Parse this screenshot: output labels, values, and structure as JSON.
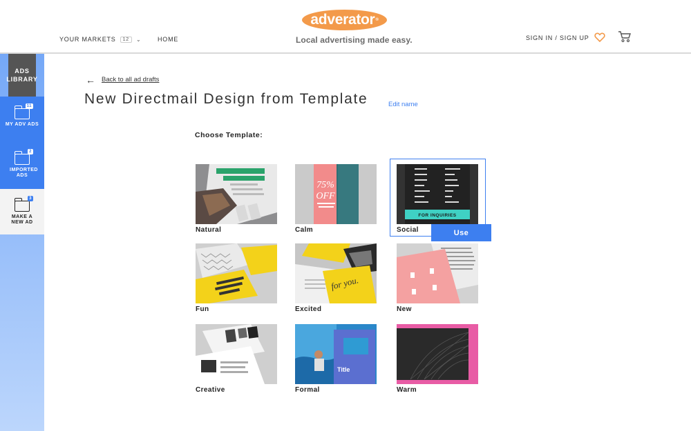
{
  "header": {
    "markets_label": "YOUR MARKETS",
    "markets_count": "12",
    "home_label": "HOME",
    "logo_text": "adverator",
    "logo_mark": "®",
    "tagline": "Local advertising made easy.",
    "signin_label": "SIGN IN / SIGN UP",
    "icons": [
      "chevron-down-icon",
      "heart-icon",
      "cart-icon"
    ]
  },
  "sidebar": {
    "library_title": "ADS LIBRARY",
    "items": [
      {
        "label": "MY ADV ADS",
        "badge": "11"
      },
      {
        "label": "IMPORTED ADS",
        "badge": "2"
      },
      {
        "label": "MAKE A NEW AD",
        "badge": "3"
      }
    ]
  },
  "main": {
    "back_label": "Back to all ad drafts",
    "title": "New Directmail Design from Template",
    "edit_label": "Edit name",
    "choose_label": "Choose Template:",
    "use_label": "Use",
    "templates": [
      {
        "name": "Natural"
      },
      {
        "name": "Calm",
        "thumb_text": "75% OFF"
      },
      {
        "name": "Social",
        "thumb_text": "FOR INQUIRIES"
      },
      {
        "name": "Fun"
      },
      {
        "name": "Excited",
        "thumb_text": "for you."
      },
      {
        "name": "New"
      },
      {
        "name": "Creative"
      },
      {
        "name": "Formal",
        "thumb_text": "Title"
      },
      {
        "name": "Warm"
      }
    ]
  },
  "colors": {
    "brand": "#f39a4a",
    "accent": "#3d7ff0",
    "sidebar_dark": "#555555"
  }
}
